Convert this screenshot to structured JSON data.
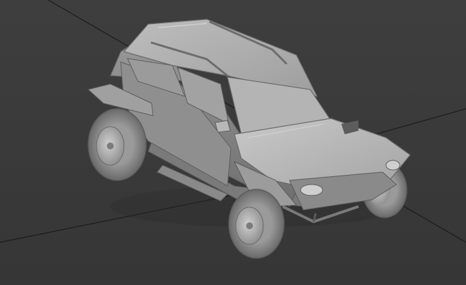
{
  "viewport": {
    "background_color": "#3a3a3a",
    "grid_line_color": "#1c1c1c"
  },
  "model": {
    "body_color": "#a9a9a9",
    "shadow_color": "#6a6a6a",
    "highlight_color": "#cfcfcf",
    "tire_color": "#8e8e8e",
    "rim_color": "#b5b5b5"
  }
}
